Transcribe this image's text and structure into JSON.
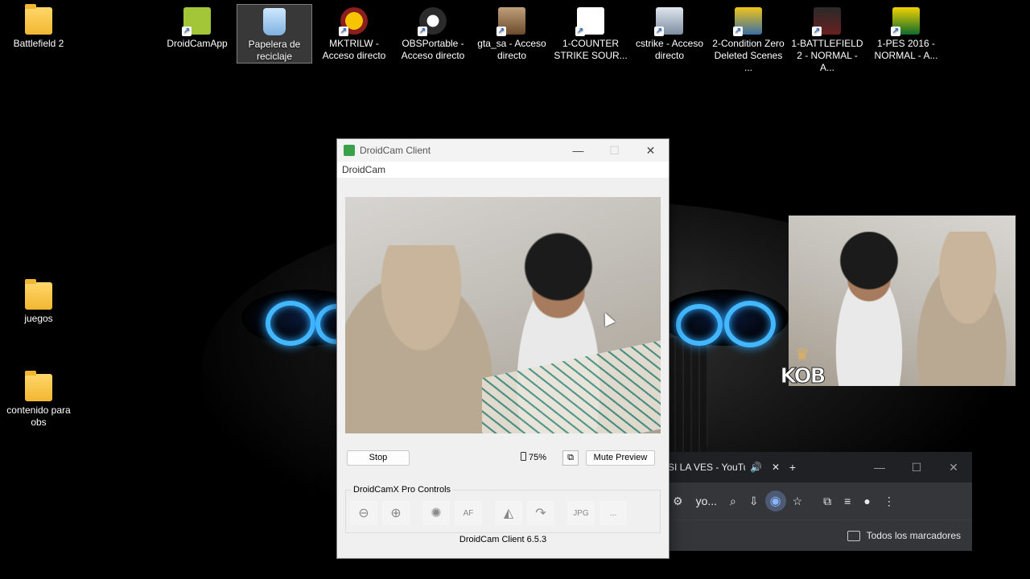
{
  "desktop": {
    "icons": [
      {
        "label": "Battlefield 2",
        "kind": "folder"
      },
      {
        "label": "DroidCamApp",
        "kind": "app"
      },
      {
        "label": "Papelera de reciclaje",
        "kind": "recycle"
      },
      {
        "label": "MKTRILW - Acceso directo",
        "kind": "shortcut"
      },
      {
        "label": "OBSPortable - Acceso directo",
        "kind": "shortcut"
      },
      {
        "label": "gta_sa - Acceso directo",
        "kind": "shortcut"
      },
      {
        "label": "1-COUNTER STRIKE SOUR...",
        "kind": "shortcut"
      },
      {
        "label": "cstrike - Acceso directo",
        "kind": "shortcut"
      },
      {
        "label": "2-Condition Zero Deleted Scenes ...",
        "kind": "shortcut"
      },
      {
        "label": "1-BATTLEFIELD 2 - NORMAL - A...",
        "kind": "shortcut"
      },
      {
        "label": "1-PES 2016 - NORMAL - A...",
        "kind": "shortcut"
      },
      {
        "label": "juegos",
        "kind": "folder"
      },
      {
        "label": "contenido para obs",
        "kind": "folder"
      }
    ],
    "overlay_logo_text": "KOB"
  },
  "droidcam": {
    "title": "DroidCam Client",
    "menu": "DroidCam",
    "stop_label": "Stop",
    "battery_percent": "75%",
    "battery_level": 0.75,
    "mute_label": "Mute Preview",
    "pro_group_label": "DroidCamX Pro Controls",
    "tools": [
      {
        "icon": "zoom-out-icon"
      },
      {
        "icon": "zoom-in-icon"
      },
      {
        "icon": "light-icon"
      },
      {
        "icon": "autofocus-icon",
        "text": "AF"
      },
      {
        "icon": "mirror-icon"
      },
      {
        "icon": "rotate-icon"
      },
      {
        "icon": "jpg-icon"
      },
      {
        "icon": "more-icon",
        "text": "..."
      }
    ],
    "version": "DroidCam Client 6.5.3"
  },
  "browser": {
    "tab_title": "SI LA VES - YouTub",
    "address_text": "yo...",
    "bookmarks_label": "Todos los marcadores"
  }
}
